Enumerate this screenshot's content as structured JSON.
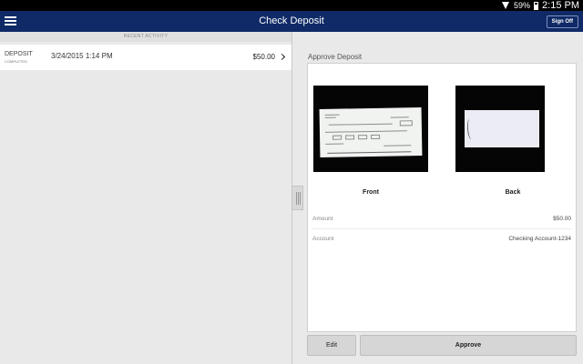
{
  "status_bar": {
    "battery": "59%",
    "time": "2:15 PM"
  },
  "app_bar": {
    "title": "Check Deposit",
    "sign_off_label": "Sign Off"
  },
  "recent_activity": {
    "header": "RECENT ACTIVITY",
    "items": [
      {
        "type": "DEPOSIT",
        "status": "COMPLETED",
        "date": "3/24/2015 1:14 PM",
        "amount": "$50.00"
      }
    ]
  },
  "approve_deposit": {
    "title": "Approve Deposit",
    "front_label": "Front",
    "back_label": "Back",
    "amount_label": "Amount",
    "amount_value": "$50.00",
    "account_label": "Account",
    "account_value": "Checking Account-1234"
  },
  "actions": {
    "edit_label": "Edit",
    "approve_label": "Approve"
  },
  "icons": [
    "menu-icon",
    "wifi-icon",
    "battery-icon",
    "chevron-right-icon",
    "drag-handle-icon"
  ],
  "colors": {
    "app_bar": "#0f2a66",
    "status_bar": "#000000",
    "background": "#e9e9e9"
  }
}
